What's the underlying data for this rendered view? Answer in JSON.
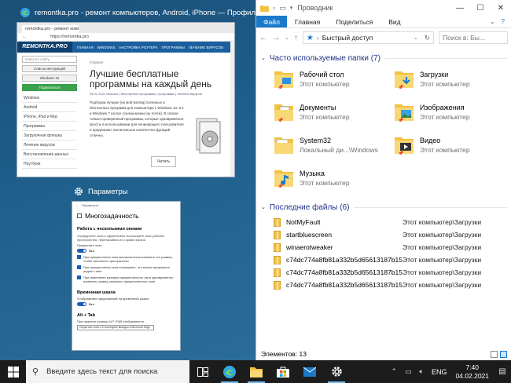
{
  "colors": {
    "accent": "#1979ca",
    "desktop": "#1f5f8c",
    "taskbar": "#1c1c1c",
    "folder": "#f3c242"
  },
  "task_view": {
    "edge_window": {
      "title": "remontka.pro - ремонт компьютеров, Android, iPhone — Профиль...",
      "icon": "edge-icon",
      "tab_label": "remontka.pro - ремонт компьютеров",
      "url": "https://remontka.pro",
      "site_logo": "REMONTKA.PRO",
      "site_nav": [
        "ГЛАВНАЯ",
        "WINDOWS",
        "НАСТРОЙКА РОУТЕРА",
        "ПРОГРАММЫ",
        "ЛЕЧЕНИЕ ВИРУСОВ"
      ],
      "search_placeholder": "поиск по сайту",
      "btn_instructions": "Список инструкций",
      "btn_windows": "Windows 10",
      "btn_subscribe": "Подписаться",
      "sidebar_items": [
        "Windows",
        "Android",
        "iPhone, iPad и Mac",
        "Программы",
        "Загрузочная флешка",
        "Лечение вирусов",
        "Восстановление данных",
        "Ноутбуки"
      ],
      "breadcrumb": "Главная",
      "article_title": "Лучшие бесплатные программы на каждый день",
      "article_meta": "05.01.2021  windows | бесплатные программы | программы | лечение вирусов",
      "article_text": "Подборка лучших (на мой взгляд) полезных и бесплатных программ для компьютера с Windows 10, 8.1 и Windows 7 на все случаи жизни (ну почти). В списке только проверенный программы, которые одновременно просты в использовании для начинающего пользователя и предлагают значительное количество функций отлично.",
      "read_button": "Читать"
    },
    "settings_window": {
      "title": "Параметры",
      "icon": "gear-icon",
      "top_label": "Параметры",
      "page_title": "Многозадачность",
      "section1": "Работа с несколькими окнами",
      "section1_desc": "Упорядочите окна и эффективно используйте свое рабочее пространство, перетаскивая их к краям экрана",
      "snap_label": "Прикрепить окна",
      "snap_state": "Вкл.",
      "options": [
        "При прикреплении окна автоматически изменять его размер, чтобы заполнить пространство",
        "При прикреплении окна показывать, что можно прикрепить рядом с ним",
        "При изменении размера прикрепленного окна одновременно изменять размер смежного прикрепленного окна"
      ],
      "section2": "Временная шкала",
      "timeline_label": "Отображение предложений на временной шкале",
      "timeline_state": "Вкл.",
      "section3": "Alt + Tab",
      "alt_tab_label": "При нажатии клавиш ALT+TAB отображаются",
      "alt_tab_value": "Открытые окна и 5 последних вкладок в Microsoft Edge"
    }
  },
  "explorer": {
    "title": "Проводник",
    "ribbon_tabs": [
      "Файл",
      "Главная",
      "Поделиться",
      "Вид"
    ],
    "address": "Быстрый доступ",
    "search_placeholder": "Поиск в: Бы...",
    "group_frequent": "Часто используемые папки (7)",
    "folders": [
      {
        "name": "Рабочий стол",
        "sub": "Этот компьютер",
        "icon": "desktop-folder-icon"
      },
      {
        "name": "Загрузки",
        "sub": "Этот компьютер",
        "icon": "downloads-folder-icon"
      },
      {
        "name": "Документы",
        "sub": "Этот компьютер",
        "icon": "documents-folder-icon"
      },
      {
        "name": "Изображения",
        "sub": "Этот компьютер",
        "icon": "pictures-folder-icon"
      },
      {
        "name": "System32",
        "sub": "Локальный ди...\\Windows",
        "icon": "folder-icon"
      },
      {
        "name": "Видео",
        "sub": "Этот компьютер",
        "icon": "videos-folder-icon"
      },
      {
        "name": "Музыка",
        "sub": "Этот компьютер",
        "icon": "music-folder-icon"
      }
    ],
    "group_recent": "Последние файлы (6)",
    "recent_files": [
      {
        "name": "NotMyFault",
        "path": "Этот компьютер\\Загрузки"
      },
      {
        "name": "startbluescreen",
        "path": "Этот компьютер\\Загрузки"
      },
      {
        "name": "winaerotweaker",
        "path": "Этот компьютер\\Загрузки"
      },
      {
        "name": "c74dc774a8fb81a332b5d65613187b15-...",
        "path": "Этот компьютер\\Загрузки"
      },
      {
        "name": "c74dc774a8fb81a332b5d65613187b15-...",
        "path": "Этот компьютер\\Загрузки"
      },
      {
        "name": "c74dc774a8fb81a332b5d65613187b15-...",
        "path": "Этот компьютер\\Загрузки"
      }
    ],
    "status": "Элементов: 13"
  },
  "taskbar": {
    "search_placeholder": "Введите здесь текст для поиска",
    "language": "ENG",
    "time": "7:40",
    "date": "04.02.2021"
  }
}
